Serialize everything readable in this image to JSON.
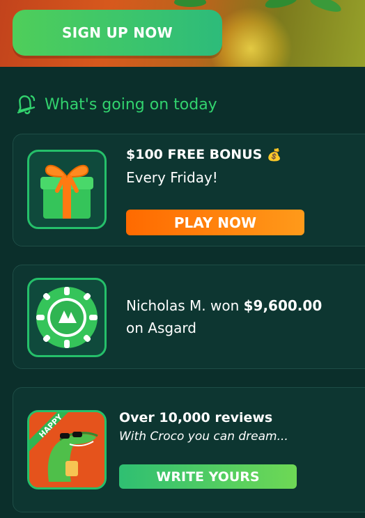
{
  "hero": {
    "signup_label": "SIGN UP NOW"
  },
  "section": {
    "title": "What's going on today",
    "icon": "bell-icon"
  },
  "cards": [
    {
      "icon": "gift-icon",
      "title": "$100 FREE BONUS",
      "title_emoji": "💰",
      "subtitle": "Every Friday!",
      "button": "PLAY NOW"
    },
    {
      "icon": "casino-chip-icon",
      "winner_prefix": "Nicholas M. won ",
      "amount": "$9,600.00",
      "game_line": "on Asgard"
    },
    {
      "icon": "happy-croco-icon",
      "badge": "HAPPY",
      "title": "Over 10,000 reviews",
      "subtitle": "With Croco you can dream...",
      "button": "WRITE YOURS"
    }
  ],
  "colors": {
    "background": "#0b2f2b",
    "accent_green": "#32d36e",
    "play_orange": "#ff7a0a",
    "write_green": "#3cc56c"
  }
}
